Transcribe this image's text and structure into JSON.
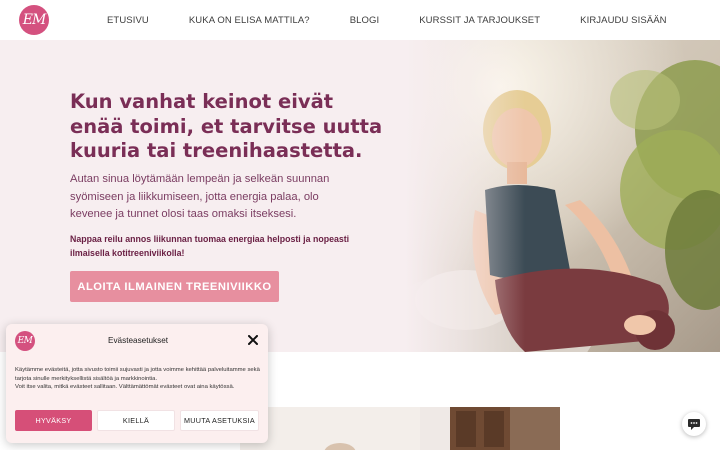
{
  "header": {
    "logo_text": "EM",
    "nav": [
      {
        "label": "ETUSIVU"
      },
      {
        "label": "KUKA ON ELISA MATTILA?"
      },
      {
        "label": "BLOGI"
      },
      {
        "label": "KURSSIT JA TARJOUKSET"
      },
      {
        "label": "KIRJAUDU SISÄÄN"
      }
    ]
  },
  "hero": {
    "title": "Kun vanhat keinot eivät enää toimi, et tarvitse uutta kuuria tai treenihaastetta.",
    "text": "Autan sinua löytämään lempeän ja selkeän suunnan syömiseen ja liikkumiseen, jotta energia palaa, olo kevenee ja tunnet olosi taas omaksi itseksesi.",
    "strong": "Nappaa reilu annos liikunnan tuomaa energiaa helposti ja nopeasti ilmaisella kotitreeniviikolla!",
    "cta_label": "ALOITA ILMAINEN TREENIVIIKKO",
    "photo_icon": "woman-photo"
  },
  "cookie": {
    "logo_text": "EM",
    "title": "Evästeasetukset",
    "close_icon": "close-icon",
    "text_line1": "Käytämme evästeitä, jotta sivusto toimii sujuvasti ja jotta voimme kehittää palveluitamme sekä tarjota sinulle merkityksellistä sisältöä ja markkinointia.",
    "text_line2": "Voit itse valita, mitkä evästeet sallitaan. Välttämättömät evästeet ovat aina käytössä.",
    "accept_label": "HYVÄKSY",
    "deny_label": "KIELLÄ",
    "settings_label": "MUUTA ASETUKSIA"
  },
  "chat": {
    "icon": "chat-bubble-icon"
  },
  "colors": {
    "brand_pink": "#d4517f",
    "title_plum": "#7a2e56",
    "cta_pink": "#e78f9f",
    "hero_bg": "#f7eef0"
  }
}
